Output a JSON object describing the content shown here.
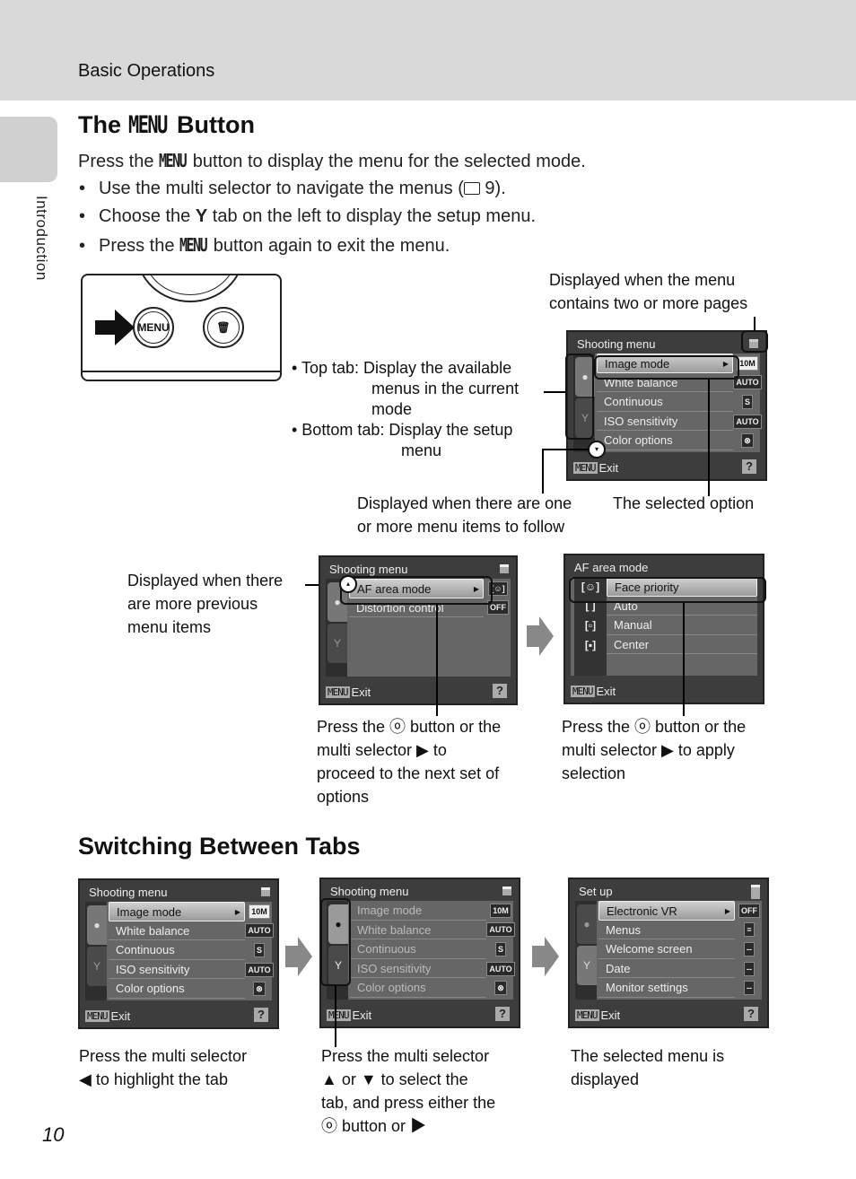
{
  "header": {
    "section": "Basic Operations"
  },
  "side_tab": {
    "label": "Introduction"
  },
  "section1": {
    "title_prefix": "The ",
    "title_menu": "MENU",
    "title_suffix": " Button",
    "intro_prefix": "Press the ",
    "intro_menu": "MENU",
    "intro_suffix": " button to display the menu for the selected mode.",
    "bullets": [
      {
        "prefix": "Use the multi selector to navigate the menus (",
        "icon": "book-icon",
        "suffix": " 9)."
      },
      {
        "prefix": "Choose the ",
        "icon": "wrench-icon",
        "suffix": " tab on the left to display the setup menu."
      },
      {
        "prefix": "Press the ",
        "icon": "MENU",
        "suffix": " button again to exit the menu."
      }
    ],
    "camera_button_label": "MENU",
    "notes": {
      "pages": [
        "Displayed when the menu",
        "contains two or more pages"
      ],
      "top_tab": "• Top tab: Display the available",
      "top_tab_2": "menus in the current",
      "top_tab_3": "mode",
      "bottom_tab": "• Bottom tab: Display the setup",
      "bottom_tab_2": "menu",
      "follow": [
        "Displayed when there are one",
        "or more menu items to follow"
      ],
      "selected_option": "The selected option",
      "previous": [
        "Displayed when there",
        "are more previous",
        "menu items"
      ],
      "press_ok_next": [
        "Press the ⓞ button or the",
        "multi selector ▶ to",
        "proceed to the next set of",
        "options"
      ],
      "press_ok_apply": [
        "Press the ⓞ button or the",
        "multi selector ▶ to apply",
        "selection"
      ]
    },
    "screen_main": {
      "title": "Shooting menu",
      "rows": [
        {
          "label": "Image mode",
          "icon": "10M",
          "selected": true
        },
        {
          "label": "White balance",
          "icon": "AUTO"
        },
        {
          "label": "Continuous",
          "icon": "S"
        },
        {
          "label": "ISO sensitivity",
          "icon": "AUTO"
        },
        {
          "label": "Color options",
          "icon": "⊗"
        }
      ],
      "footer_menu": "MENU",
      "footer_exit": "Exit",
      "help": "?"
    },
    "screen_af": {
      "title": "Shooting menu",
      "rows": [
        {
          "label": "AF area mode",
          "icon": "[☺]",
          "selected": true
        },
        {
          "label": "Distortion control",
          "icon": "OFF"
        }
      ],
      "footer_menu": "MENU",
      "footer_exit": "Exit",
      "help": "?"
    },
    "screen_af_options": {
      "title": "AF area mode",
      "rows": [
        {
          "label": "Face priority",
          "icon": "[☺]",
          "selected": true
        },
        {
          "label": "Auto",
          "icon": "[ ]"
        },
        {
          "label": "Manual",
          "icon": "[▫]"
        },
        {
          "label": "Center",
          "icon": "[▪]"
        }
      ],
      "footer_menu": "MENU",
      "footer_exit": "Exit"
    }
  },
  "section2": {
    "title": "Switching Between Tabs",
    "screen_1": {
      "title": "Shooting menu",
      "rows": [
        {
          "label": "Image mode",
          "icon": "10M",
          "selected": true
        },
        {
          "label": "White balance",
          "icon": "AUTO"
        },
        {
          "label": "Continuous",
          "icon": "S"
        },
        {
          "label": "ISO sensitivity",
          "icon": "AUTO"
        },
        {
          "label": "Color options",
          "icon": "⊗"
        }
      ],
      "footer_menu": "MENU",
      "footer_exit": "Exit",
      "help": "?"
    },
    "screen_2": {
      "title": "Shooting menu",
      "rows": [
        {
          "label": "Image mode",
          "icon": "10M"
        },
        {
          "label": "White balance",
          "icon": "AUTO"
        },
        {
          "label": "Continuous",
          "icon": "S"
        },
        {
          "label": "ISO sensitivity",
          "icon": "AUTO"
        },
        {
          "label": "Color options",
          "icon": "⊗"
        }
      ],
      "footer_menu": "MENU",
      "footer_exit": "Exit",
      "help": "?"
    },
    "screen_3": {
      "title": "Set up",
      "rows": [
        {
          "label": "Electronic VR",
          "icon": "OFF",
          "selected": true
        },
        {
          "label": "Menus",
          "icon": "≡"
        },
        {
          "label": "Welcome screen",
          "icon": "--"
        },
        {
          "label": "Date",
          "icon": "--"
        },
        {
          "label": "Monitor settings",
          "icon": "--"
        }
      ],
      "footer_menu": "MENU",
      "footer_exit": "Exit",
      "help": "?"
    },
    "captions": {
      "c1": [
        "Press the multi selector",
        "◀  to highlight the tab"
      ],
      "c2": [
        "Press the multi selector",
        "▲ or ▼ to select the",
        "tab, and press either the",
        "ⓞ button or ▶"
      ],
      "c3": [
        "The selected menu is",
        "displayed"
      ]
    }
  },
  "page_number": "10"
}
